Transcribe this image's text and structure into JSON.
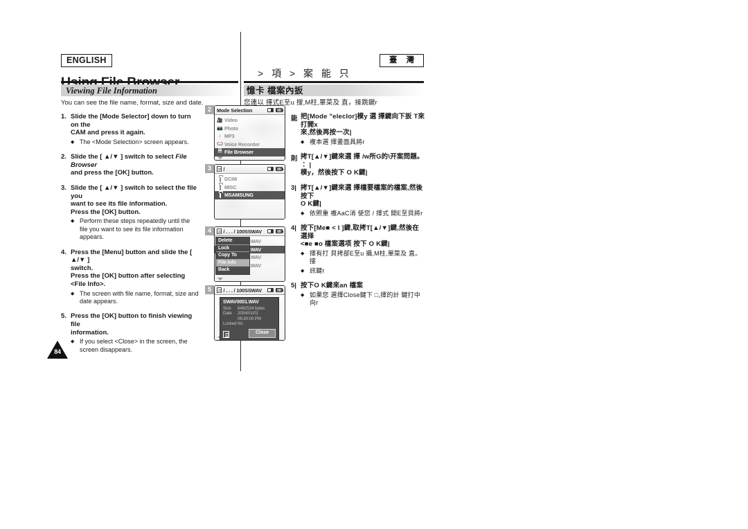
{
  "header": {
    "language_badge": "ENGLISH",
    "region_badge": "臺 灣",
    "title_en": "Using File Browser",
    "title_cn": "> 項 > 案 能 只"
  },
  "section": {
    "title_en": "Viewing File Information",
    "title_cn": "憶卡 檔案內扳",
    "lead_en": "You can see the file name, format, size and date.",
    "lead_cn": "您連以 擇式E至u 搜,M柱,單菜及 直，接跳鍵r"
  },
  "steps_en": [
    {
      "num": "1.",
      "lines": [
        "Slide the [Mode Selector] down to turn on the",
        "CAM and press it again."
      ],
      "bullets": [
        "The <Mode Selection> screen appears."
      ]
    },
    {
      "num": "2.",
      "lines_rich": [
        {
          "parts": [
            {
              "t": "Slide the [ ▲/▼ ] switch to select ",
              "i": false
            },
            {
              "t": "File Browser",
              "i": true
            }
          ]
        },
        {
          "parts": [
            {
              "t": "and press the [OK] button.",
              "i": false
            }
          ]
        }
      ],
      "bullets": []
    },
    {
      "num": "3.",
      "lines": [
        "Slide the [ ▲/▼ ] switch to select the file you",
        "want to see its file information.",
        "Press the [OK] button."
      ],
      "bullets": [
        "Perform these steps repeatedly until the file you want to see its file information appears."
      ]
    },
    {
      "num": "4.",
      "lines": [
        "Press the [Menu] button and slide the [ ▲/▼ ]",
        "switch.",
        "Press the [OK] button after selecting",
        "<File Info>."
      ],
      "bullets": [
        "The screen with file name, format, size and date appears."
      ]
    },
    {
      "num": "5.",
      "lines": [
        "Press the [OK] button to finish viewing file",
        "information."
      ],
      "bullets": [
        "If you select <Close> in the screen, the screen disappears."
      ]
    }
  ],
  "steps_cn": [
    {
      "num": "能",
      "lines": [
        "把[Mode \"elecIor]模y 選 擇鍵向下扳 T來打開x",
        "來,然後再按一次|"
      ],
      "bullets": [
        "複本選 擇畫面具將r"
      ]
    },
    {
      "num": "則",
      "lines": [
        "拷T[▲/▼]鍵來選 擇 /w所G的\\开案問題。 ∶ |",
        "模y，然後按下 O K鍵|"
      ],
      "bullets": []
    },
    {
      "num": "3|",
      "lines": [
        "拷T[▲/▼]鍵來選 擇檔要檔案的檔案,然後按下",
        "O K鍵|"
      ],
      "bullets": [
        "依照重 複AaC消 使您 / 擇式 開E至貝將r"
      ]
    },
    {
      "num": "4|",
      "lines": [
        "按下[Me■ < I ]鍵,取拷T[▲/▼]鍵,然後在 選择",
        "<■e ■o 檔案選项 按下 O K鍵|"
      ],
      "bullets": [
        "擇有打 貝拷部E至u 攝,M柱,單菜及 直。 接",
        "訊鍵r"
      ]
    },
    {
      "num": "5|",
      "lines": [
        "按下O K鍵來an 檔案"
      ],
      "bullets": [
        "如果您 選擇Close鍵下 □,擇的計 鍵打中向r"
      ]
    }
  ],
  "page_number": "84",
  "lcd_screens": [
    {
      "badge": "2",
      "name": "mode-selection",
      "titlebar": "Mode Selection",
      "title_icon": "document-icon",
      "show_title_doc_icon": false,
      "rows": [
        {
          "label": "Video",
          "icon": "video-icon",
          "selected": false
        },
        {
          "label": "Photo",
          "icon": "photo-icon",
          "selected": false
        },
        {
          "label": "MP3",
          "icon": "music-note-icon",
          "selected": false
        },
        {
          "label": "Voice Recorder",
          "icon": "microphone-icon",
          "selected": false
        },
        {
          "label": "File Browser",
          "icon": "file-browser-icon",
          "selected": true
        }
      ],
      "scroll_down": true
    },
    {
      "badge": "3",
      "name": "root-folder-list",
      "titlebar": "/",
      "show_title_doc_icon": true,
      "rows": [
        {
          "label": "DCIM",
          "icon": "folder-icon",
          "selected": false
        },
        {
          "label": "MISC",
          "icon": "folder-icon",
          "selected": false
        },
        {
          "label": "MSAMSUNG",
          "icon": "folder-icon",
          "selected": true
        }
      ],
      "scroll_down": false
    },
    {
      "badge": "4",
      "name": "file-list-with-context-menu",
      "titlebar": "/ . . . / 100SSWAV",
      "show_title_doc_icon": true,
      "rows": [
        {
          "label": "SWAV0001.WAV",
          "icon": "audio-file-icon",
          "selected": false
        },
        {
          "label": "SWAV0002.WAV",
          "icon": "audio-file-icon",
          "selected": true
        },
        {
          "label": "SWAV0003.WAV",
          "icon": "audio-file-icon",
          "selected": false
        },
        {
          "label": "SWAV0004.WAV",
          "icon": "audio-file-icon",
          "selected": false
        }
      ],
      "context_menu": [
        {
          "label": "Delete",
          "highlighted": false
        },
        {
          "label": "Lock",
          "highlighted": false
        },
        {
          "label": "Copy To",
          "highlighted": false
        },
        {
          "label": "File Info",
          "highlighted": true
        },
        {
          "label": "Back",
          "highlighted": false
        }
      ],
      "scroll_down": true
    },
    {
      "badge": "5",
      "name": "file-info-dialog",
      "titlebar": "/ . . . / 100SSWAV",
      "show_title_doc_icon": true,
      "rows": [],
      "file_info": {
        "filename": "SWAV0001.WAV",
        "fields": [
          {
            "key": "Size",
            "value": "6482524 bytes"
          },
          {
            "key": "Date",
            "value": "2004/01/01"
          },
          {
            "key": "",
            "value": "06:30:00 PM"
          },
          {
            "key": "Locked",
            "value": "No"
          }
        ],
        "close_label": "Close",
        "doc_icon": "document-icon"
      },
      "scroll_down": true
    }
  ],
  "colors": {
    "selection": "#575757",
    "menu_bg": "#4a4a4a",
    "menu_highlight": "#b2b2b2",
    "badge_gray": "#a9a9a9",
    "section_bar": "#d4d4d4"
  }
}
